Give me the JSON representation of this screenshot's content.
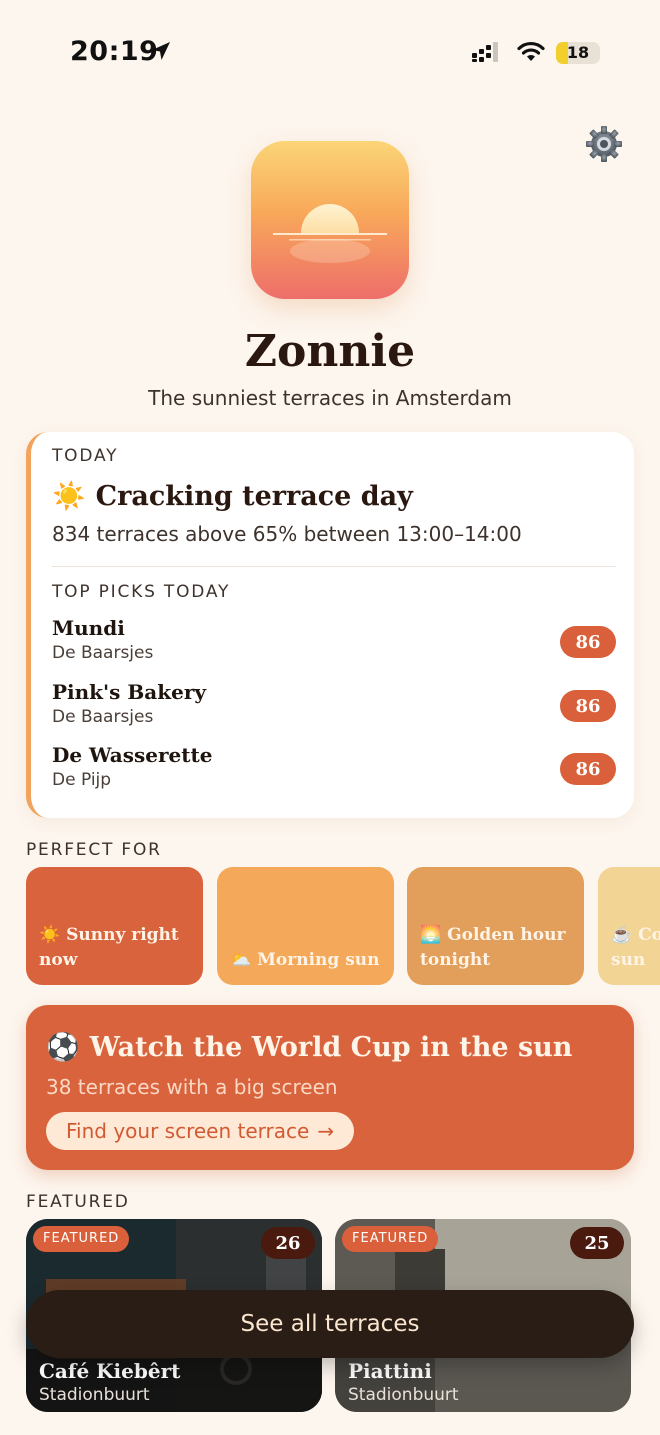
{
  "status_bar": {
    "time": "20:19",
    "battery": "18"
  },
  "header": {
    "title": "Zonnie",
    "subtitle": "The sunniest terraces in Amsterdam"
  },
  "today": {
    "label": "TODAY",
    "icon": "☀️",
    "headline": "Cracking terrace day",
    "summary": "834 terraces above 65% between 13:00–14:00",
    "picks_label": "TOP PICKS TODAY",
    "picks": [
      {
        "name": "Mundi",
        "area": "De Baarsjes",
        "score": "86"
      },
      {
        "name": "Pink's Bakery",
        "area": "De Baarsjes",
        "score": "86"
      },
      {
        "name": "De Wasserette",
        "area": "De Pijp",
        "score": "86"
      }
    ]
  },
  "perfect_for": {
    "label": "PERFECT FOR",
    "tiles": [
      {
        "icon": "☀️",
        "line1": "Sunny right",
        "line2": "now",
        "color": "#d9633d"
      },
      {
        "icon": "⛅",
        "line1": "Morning sun",
        "line2": "",
        "color": "#f4a85a"
      },
      {
        "icon": "🌅",
        "line1": "Golden hour",
        "line2": "tonight",
        "color": "#e29f5c"
      },
      {
        "icon": "☕",
        "line1": "Co",
        "line2": "sun",
        "color": "#f2d494"
      }
    ]
  },
  "world_cup": {
    "icon": "⚽",
    "title": "Watch the World Cup in the sun",
    "subtitle": "38 terraces with a big screen",
    "cta": "Find your screen terrace",
    "cta_arrow": "→"
  },
  "featured": {
    "label": "FEATURED",
    "cards": [
      {
        "badge": "FEATURED",
        "score": "26",
        "name": "Café Kiebêrt",
        "area": "Stadionbuurt"
      },
      {
        "badge": "FEATURED",
        "score": "25",
        "name": "Piattini",
        "area": "Stadionbuurt"
      }
    ]
  },
  "see_all": "See all terraces",
  "colors": {
    "accent": "#d9603a",
    "background": "#fdf6ee",
    "dark": "#2a1d16"
  }
}
